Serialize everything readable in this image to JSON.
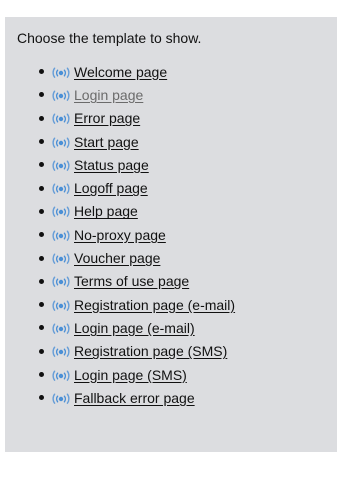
{
  "heading": "Choose the template to show.",
  "colors": {
    "panel_background": "#dcdde0",
    "text": "#111111",
    "visited_link": "#6b6b6b",
    "icon_blue": "#4a8fd6"
  },
  "templates": [
    {
      "label": "Welcome page",
      "icon": "wifi-signal-icon",
      "visited": false
    },
    {
      "label": "Login page",
      "icon": "wifi-signal-icon",
      "visited": true
    },
    {
      "label": "Error page",
      "icon": "wifi-signal-icon",
      "visited": false
    },
    {
      "label": "Start page",
      "icon": "wifi-signal-icon",
      "visited": false
    },
    {
      "label": "Status page",
      "icon": "wifi-signal-icon",
      "visited": false
    },
    {
      "label": "Logoff page",
      "icon": "wifi-signal-icon",
      "visited": false
    },
    {
      "label": "Help page",
      "icon": "wifi-signal-icon",
      "visited": false
    },
    {
      "label": "No-proxy page",
      "icon": "wifi-signal-icon",
      "visited": false
    },
    {
      "label": "Voucher page",
      "icon": "wifi-signal-icon",
      "visited": false
    },
    {
      "label": "Terms of use page",
      "icon": "wifi-signal-icon",
      "visited": false
    },
    {
      "label": "Registration page (e-mail)",
      "icon": "wifi-signal-icon",
      "visited": false
    },
    {
      "label": "Login page (e-mail)",
      "icon": "wifi-signal-icon",
      "visited": false
    },
    {
      "label": "Registration page (SMS)",
      "icon": "wifi-signal-icon",
      "visited": false
    },
    {
      "label": "Login page (SMS)",
      "icon": "wifi-signal-icon",
      "visited": false
    },
    {
      "label": "Fallback error page",
      "icon": "wifi-signal-icon",
      "visited": false
    }
  ]
}
